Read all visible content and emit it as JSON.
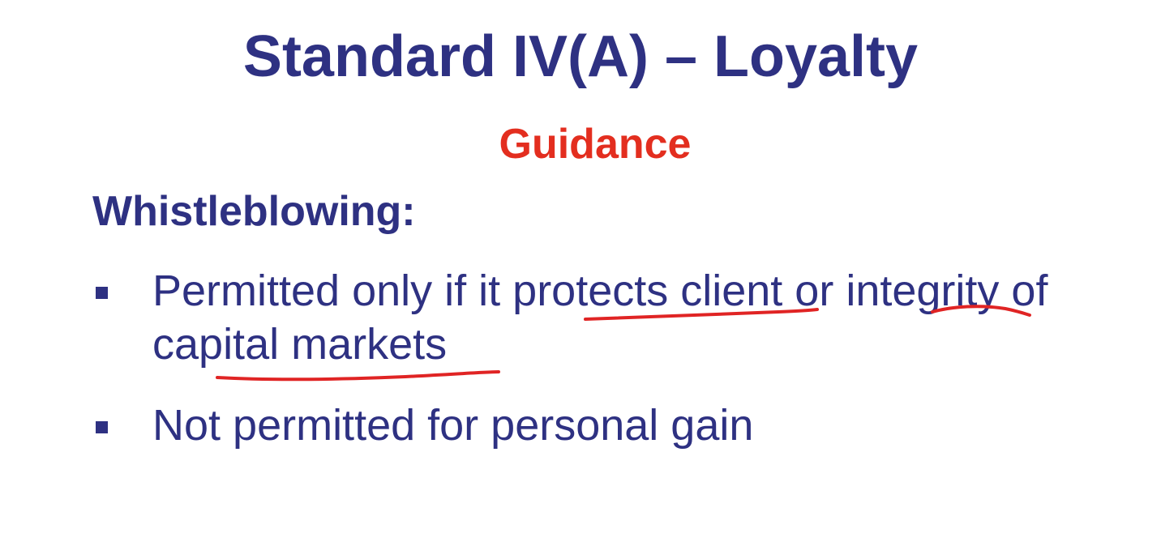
{
  "slide": {
    "title": "Standard IV(A) – Loyalty",
    "subtitle": "Guidance",
    "section_heading": "Whistleblowing:",
    "bullets": [
      "Permitted only if it protects client or integrity of capital markets",
      "Not permitted for personal gain"
    ]
  },
  "colors": {
    "title": "#2e3182",
    "subtitle": "#e32e1f",
    "annotation": "#e02424"
  }
}
